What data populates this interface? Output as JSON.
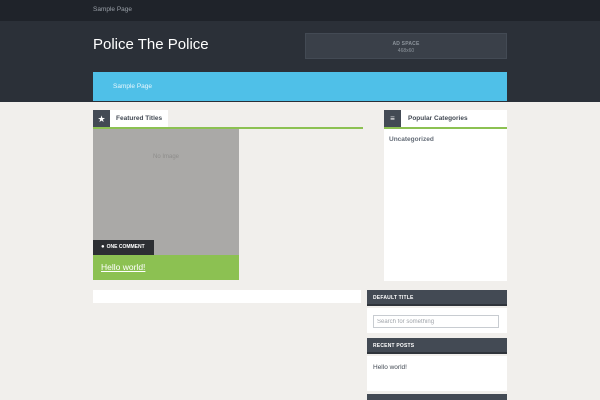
{
  "topbar": {
    "link": "Sample Page"
  },
  "header": {
    "site_title": "Police The Police",
    "ad": {
      "line1": "AD SPACE",
      "line2": "468x60"
    }
  },
  "nav": {
    "items": [
      "Sample Page"
    ]
  },
  "featured": {
    "title": "Featured Titles",
    "icon": "star-icon",
    "card": {
      "image_placeholder": "No Image",
      "comments": "ONE COMMENT",
      "post_title": "Hello world!"
    }
  },
  "popular_categories": {
    "title": "Popular Categories",
    "icon": "list-icon",
    "items": [
      "Uncategorized"
    ]
  },
  "sidebar": {
    "default_widget": {
      "title": "DEFAULT TITLE",
      "search_placeholder": "Search for something"
    },
    "recent_posts": {
      "title": "RECENT POSTS",
      "items": [
        "Hello world!"
      ]
    }
  },
  "colors": {
    "topbar": "#1f232a",
    "header": "#2b3038",
    "nav_accent": "#4fc0e8",
    "green_accent": "#8cc152",
    "dark_widget": "#434a54",
    "page_bg": "#f1efec"
  }
}
